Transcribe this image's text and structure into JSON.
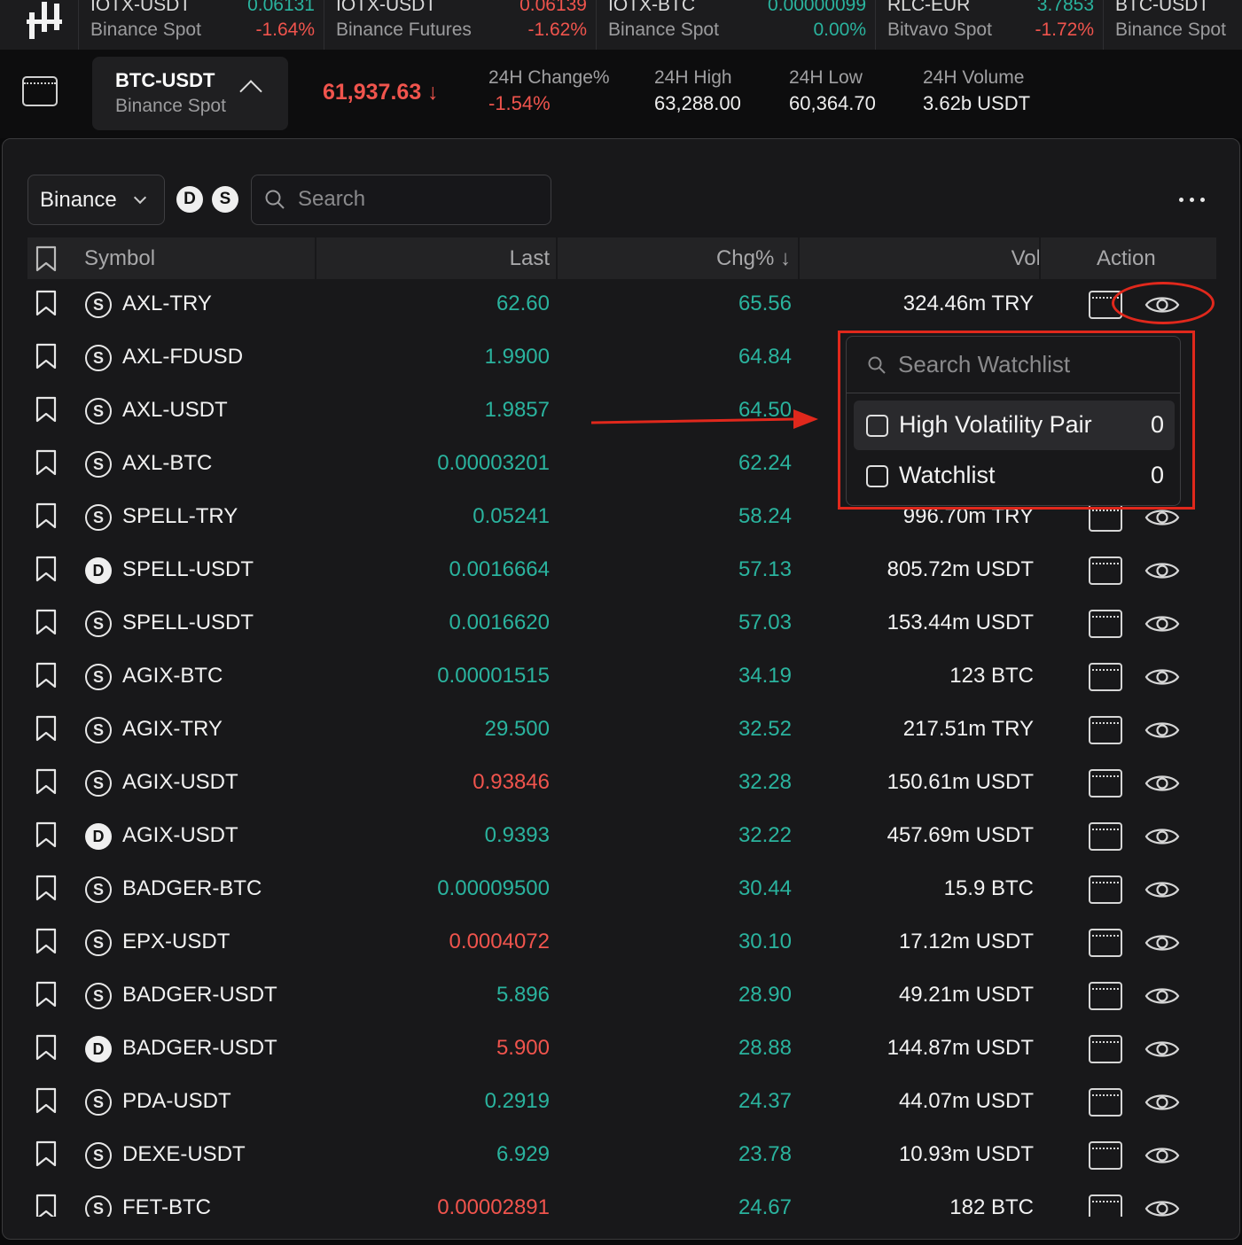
{
  "ticker_strip": [
    {
      "symbol": "IOTX-USDT",
      "source": "Binance Spot",
      "last": "0.06131",
      "change": "-1.64%",
      "last_dir": "up",
      "change_dir": "down"
    },
    {
      "symbol": "IOTX-USDT",
      "source": "Binance Futures",
      "last": "0.06139",
      "change": "-1.62%",
      "last_dir": "down",
      "change_dir": "down"
    },
    {
      "symbol": "IOTX-BTC",
      "source": "Binance Spot",
      "last": "0.00000099",
      "change": "0.00%",
      "last_dir": "up",
      "change_dir": "up"
    },
    {
      "symbol": "RLC-EUR",
      "source": "Bitvavo Spot",
      "last": "3.7853",
      "change": "-1.72%",
      "last_dir": "up",
      "change_dir": "down"
    },
    {
      "symbol": "BTC-USDT",
      "source": "Binance Spot",
      "last": "",
      "change": "",
      "last_dir": "up",
      "change_dir": "up"
    }
  ],
  "header": {
    "pair_symbol": "BTC-USDT",
    "pair_source": "Binance Spot",
    "price": "61,937.63",
    "price_arrow": "↓",
    "stats": [
      {
        "label": "24H Change%",
        "value": "-1.54%"
      },
      {
        "label": "24H High",
        "value": "63,288.00"
      },
      {
        "label": "24H Low",
        "value": "60,364.70"
      },
      {
        "label": "24H Volume",
        "value": "3.62b USDT"
      }
    ]
  },
  "filters": {
    "exchange": "Binance",
    "badge_d": "D",
    "badge_s": "S",
    "search_placeholder": "Search"
  },
  "table": {
    "columns": {
      "symbol": "Symbol",
      "last": "Last",
      "chg": "Chg%",
      "chg_sort": "↓",
      "vol": "Vol",
      "action": "Action"
    },
    "rows": [
      {
        "type": "S",
        "symbol": "AXL-TRY",
        "last": "62.60",
        "last_dir": "up",
        "chg": "65.56",
        "vol": "324.46m TRY"
      },
      {
        "type": "S",
        "symbol": "AXL-FDUSD",
        "last": "1.9900",
        "last_dir": "up",
        "chg": "64.84",
        "vol": ""
      },
      {
        "type": "S",
        "symbol": "AXL-USDT",
        "last": "1.9857",
        "last_dir": "up",
        "chg": "64.50",
        "vol": ""
      },
      {
        "type": "S",
        "symbol": "AXL-BTC",
        "last": "0.00003201",
        "last_dir": "up",
        "chg": "62.24",
        "vol": ""
      },
      {
        "type": "S",
        "symbol": "SPELL-TRY",
        "last": "0.05241",
        "last_dir": "up",
        "chg": "58.24",
        "vol": "996.70m TRY"
      },
      {
        "type": "D",
        "symbol": "SPELL-USDT",
        "last": "0.0016664",
        "last_dir": "up",
        "chg": "57.13",
        "vol": "805.72m USDT"
      },
      {
        "type": "S",
        "symbol": "SPELL-USDT",
        "last": "0.0016620",
        "last_dir": "up",
        "chg": "57.03",
        "vol": "153.44m USDT"
      },
      {
        "type": "S",
        "symbol": "AGIX-BTC",
        "last": "0.00001515",
        "last_dir": "up",
        "chg": "34.19",
        "vol": "123 BTC"
      },
      {
        "type": "S",
        "symbol": "AGIX-TRY",
        "last": "29.500",
        "last_dir": "up",
        "chg": "32.52",
        "vol": "217.51m TRY"
      },
      {
        "type": "S",
        "symbol": "AGIX-USDT",
        "last": "0.93846",
        "last_dir": "down",
        "chg": "32.28",
        "vol": "150.61m USDT"
      },
      {
        "type": "D",
        "symbol": "AGIX-USDT",
        "last": "0.9393",
        "last_dir": "up",
        "chg": "32.22",
        "vol": "457.69m USDT"
      },
      {
        "type": "S",
        "symbol": "BADGER-BTC",
        "last": "0.00009500",
        "last_dir": "up",
        "chg": "30.44",
        "vol": "15.9 BTC"
      },
      {
        "type": "S",
        "symbol": "EPX-USDT",
        "last": "0.0004072",
        "last_dir": "down",
        "chg": "30.10",
        "vol": "17.12m USDT"
      },
      {
        "type": "S",
        "symbol": "BADGER-USDT",
        "last": "5.896",
        "last_dir": "up",
        "chg": "28.90",
        "vol": "49.21m USDT"
      },
      {
        "type": "D",
        "symbol": "BADGER-USDT",
        "last": "5.900",
        "last_dir": "down",
        "chg": "28.88",
        "vol": "144.87m USDT"
      },
      {
        "type": "S",
        "symbol": "PDA-USDT",
        "last": "0.2919",
        "last_dir": "up",
        "chg": "24.37",
        "vol": "44.07m USDT"
      },
      {
        "type": "S",
        "symbol": "DEXE-USDT",
        "last": "6.929",
        "last_dir": "up",
        "chg": "23.78",
        "vol": "10.93m USDT"
      },
      {
        "type": "S",
        "symbol": "FET-BTC",
        "last": "0.00002891",
        "last_dir": "down",
        "chg": "24.67",
        "vol": "182 BTC"
      }
    ]
  },
  "watchlist_popup": {
    "search_placeholder": "Search Watchlist",
    "items": [
      {
        "label": "High Volatility Pair",
        "count": "0"
      },
      {
        "label": "Watchlist",
        "count": "0"
      }
    ]
  },
  "colors": {
    "up": "#2ab39e",
    "down": "#f0544d",
    "annotation": "#e0281c"
  },
  "icons": [
    "app-logo-icon",
    "layout-icon",
    "chevron-up-icon",
    "chevron-down-icon",
    "search-icon",
    "more-icon",
    "bookmark-icon",
    "chart-window-icon",
    "eye-icon",
    "checkbox-icon"
  ]
}
